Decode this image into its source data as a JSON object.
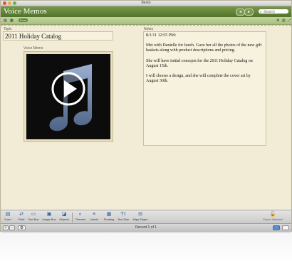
{
  "window": {
    "title": "Bento"
  },
  "header": {
    "app_title": "Voice Memos",
    "nav_back": "◂",
    "nav_forward": "▸",
    "search_placeholder": "Search"
  },
  "subbar": {
    "pill_label": "Form"
  },
  "form": {
    "topic_label": "Topic",
    "topic_value": "2011 Holiday Catalog",
    "voice_memo_label": "Voice Memo",
    "notes_label": "Notes",
    "notes_paragraphs": [
      "8/1/11 12:55 PM:",
      "Met with Danielle for lunch. Gave her all the photos of the new gift baskets along with product descriptions and pricing.",
      "She will have initial concepts for the 2011 Holiday Catalog on August 15th.",
      "I will choose a design, and she will complete the cover art by August 30th."
    ]
  },
  "toolbar": {
    "tools": [
      {
        "label": "Form",
        "icon": "form-icon",
        "glyph": "▤"
      },
      {
        "label": "Field",
        "icon": "field-icon",
        "glyph": "⇄"
      },
      {
        "label": "Text Box",
        "icon": "text-box-icon",
        "glyph": "▭"
      },
      {
        "label": "Image Box",
        "icon": "image-box-icon",
        "glyph": "▣"
      },
      {
        "label": "Objects",
        "icon": "objects-icon",
        "glyph": "◪"
      },
      {
        "label": "Themes",
        "icon": "themes-icon",
        "glyph": "◐"
      },
      {
        "label": "Labels",
        "icon": "labels-icon",
        "glyph": "≡"
      },
      {
        "label": "Shading",
        "icon": "shading-icon",
        "glyph": "▦"
      },
      {
        "label": "Text Size",
        "icon": "text-size-icon",
        "glyph": "Tт"
      },
      {
        "label": "Align Edges",
        "icon": "align-edges-icon",
        "glyph": "⊟"
      }
    ],
    "form_unlocked_label": "Form Unlocked"
  },
  "statusbar": {
    "record_text": "Record 1 of 1",
    "add_label": "+",
    "remove_label": "−",
    "action_label": "⚙"
  },
  "colors": {
    "header_green": "#5b7f34",
    "background_parchment": "#f2ecd7",
    "accent_blue": "#2f5d9a"
  }
}
